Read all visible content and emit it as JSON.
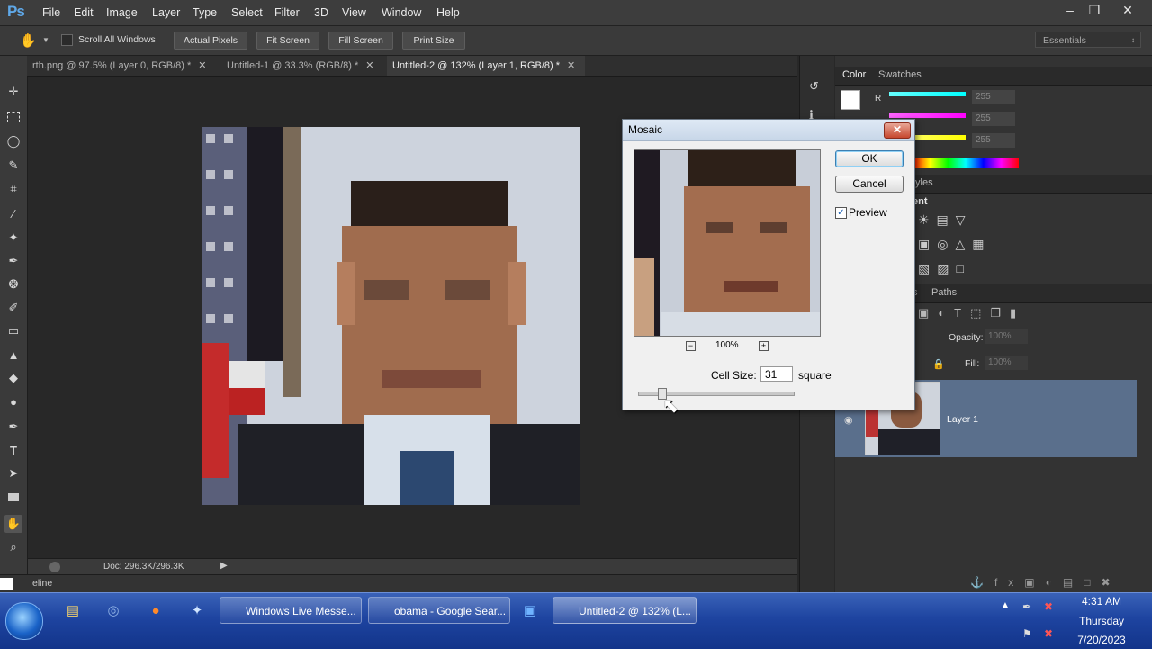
{
  "app": {
    "logo": "Ps"
  },
  "menu": [
    "File",
    "Edit",
    "Image",
    "Layer",
    "Type",
    "Select",
    "Filter",
    "3D",
    "View",
    "Window",
    "Help"
  ],
  "options_bar": {
    "scroll_all_windows": "Scroll All Windows",
    "actual_pixels": "Actual Pixels",
    "fit_screen": "Fit Screen",
    "fill_screen": "Fill Screen",
    "print_size": "Print Size",
    "workspace": "Essentials"
  },
  "tabs": [
    {
      "label": "rth.png @ 97.5% (Layer 0, RGB/8) *"
    },
    {
      "label": "Untitled-1 @ 33.3% (RGB/8) *"
    },
    {
      "label": "Untitled-2 @ 132% (Layer 1, RGB/8) *"
    }
  ],
  "status": {
    "doc": "Doc: 296.3K/296.3K",
    "timeline": "eline"
  },
  "right_panel": {
    "color_tab": "Color",
    "swatches_tab": "Swatches",
    "channel_r": "R",
    "slider_value": "255",
    "styles_partial": "tyles",
    "adjust_partial": "ent",
    "layers_partial": "s",
    "paths_tab": "Paths",
    "opacity_label": "Opacity:",
    "opacity_value": "100%",
    "fill_label": "Fill:",
    "fill_value": "100%",
    "layer_name": "Layer 1"
  },
  "dialog": {
    "title": "Mosaic",
    "ok": "OK",
    "cancel": "Cancel",
    "preview_label": "Preview",
    "preview_checked": true,
    "zoom": "100%",
    "cell_size_label": "Cell Size:",
    "cell_size_value": "31",
    "unit": "square",
    "slider_fraction": 0.15
  },
  "taskbar": {
    "items": [
      "Windows Live Messe...",
      "obama - Google Sear...",
      "Untitled-2 @ 132% (L..."
    ],
    "time": "4:31 AM",
    "day": "Thursday",
    "date": "7/20/2023"
  }
}
